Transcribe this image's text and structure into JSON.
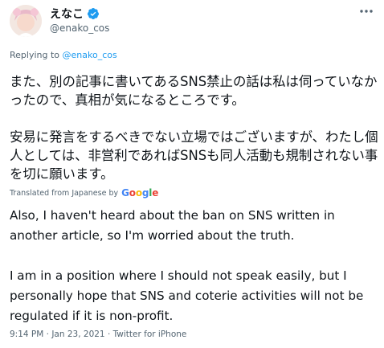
{
  "user": {
    "display_name": "えなこ",
    "handle": "@enako_cos"
  },
  "reply": {
    "prefix": "Replying to ",
    "mention": "@enako_cos"
  },
  "tweet": {
    "text": "また、別の記事に書いてあるSNS禁止の話は私は伺っていなかったので、真相が気になるところです。\n\n安易に発言をするべきでない立場ではございますが、わたし個人としては、非営利であればSNSも同人活動も規制されない事を切に願います。"
  },
  "translation": {
    "label": "Translated from Japanese by",
    "provider": "Google",
    "text": "Also, I haven't heard about the ban on SNS written in another article, so I'm worried about the truth.\n\n I am in a position where I should not speak easily, but I personally hope that SNS and coterie activities will not be regulated if it is non-profit."
  },
  "meta": {
    "time": "9:14 PM",
    "date": "Jan 23, 2021",
    "source": "Twitter for iPhone",
    "separator": " · "
  },
  "colors": {
    "accent": "#1d9bf0",
    "secondary_text": "#536471"
  },
  "icons": {
    "verified": "verified-badge-icon",
    "more": "more-options-icon"
  }
}
